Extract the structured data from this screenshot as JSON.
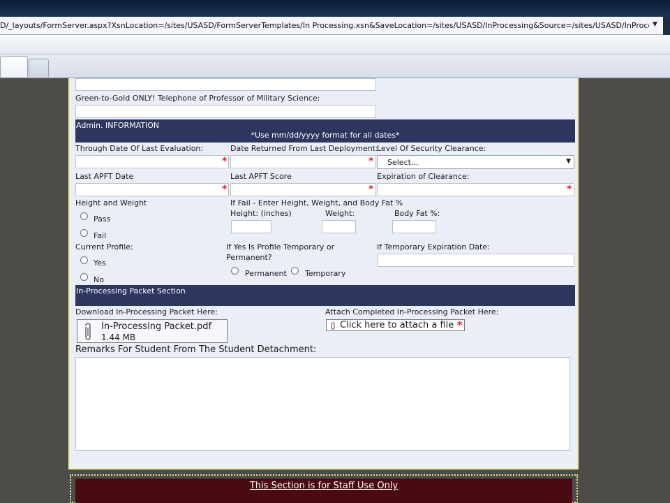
{
  "browser": {
    "url": "D/_layouts/FormServer.aspx?XsnLocation=/sites/USASD/FormServerTemplates/In Processing.xsn&SaveLocation=/sites/USASD/InProcessing&Source=/sites/USASD/InProcessing",
    "dropdown_icon": "▼"
  },
  "form": {
    "g2g_phone_label": "Green-to-Gold ONLY! Telephone of Professor of Military Science:",
    "admin_section": {
      "title": "Admin. INFORMATION",
      "date_note": "*Use mm/dd/yyyy format for all dates*"
    },
    "through_date_label": "Through Date Of Last Evaluation:",
    "date_returned_label": "Date Returned From Last Deployment:",
    "security_level_label": "Level Of Security Clearance:",
    "security_select_value": "Select...",
    "last_apft_date_label": "Last APFT Date",
    "last_apft_score_label": "Last APFT Score",
    "expiration_label": "Expiration of Clearance:",
    "height_weight_label": "Height and Weight",
    "pass_label": "Pass",
    "fail_label": "Fail",
    "if_fail_label": "If Fail - Enter Height, Weight, and Body Fat %",
    "height_label": "Height: (inches)",
    "weight_label": "Weight:",
    "bodyfat_label": "Body Fat %:",
    "current_profile_label": "Current Profile:",
    "yes_label": "Yes",
    "no_label": "No",
    "profile_temp_label_line1": "If Yes Is Profile Temporary or",
    "profile_temp_label_line2": "Permanent?",
    "permanent_label": "Permanent",
    "temporary_label": "Temporary",
    "temp_exp_label": "If Temporary Expiration Date:",
    "required_mark": "*",
    "packet_section": {
      "title": "In-Processing Packet Section"
    },
    "download_label": "Download In-Processing Packet Here:",
    "packet_file_name": "In-Processing Packet.pdf",
    "packet_file_size": "1.44 MB",
    "attach_label": "Attach Completed In-Processing Packet Here:",
    "attach_button": "Click here to attach a file",
    "remarks_label": "Remarks For Student From The Student Detachment:"
  },
  "staff": {
    "title": "This Section is for Staff Use Only"
  }
}
